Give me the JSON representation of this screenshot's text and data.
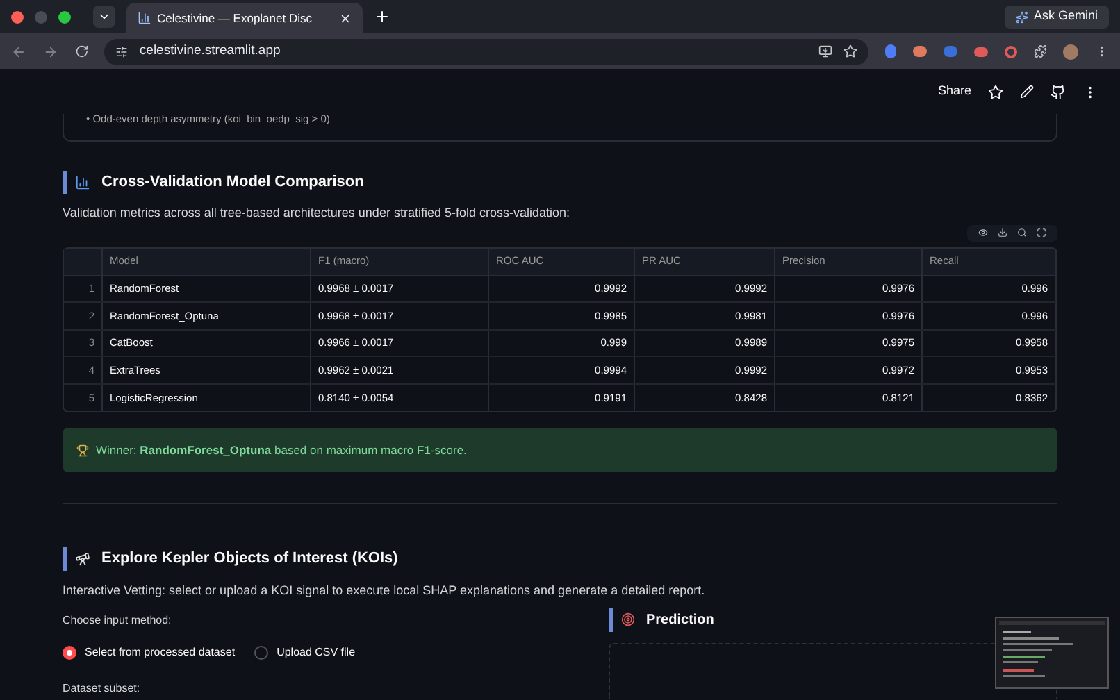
{
  "browser": {
    "tab_title": "Celestivine — Exoplanet Disc",
    "url": "celestivine.streamlit.app",
    "ask_button": "Ask Gemini"
  },
  "header": {
    "share": "Share"
  },
  "prev_note": "• Odd-even depth asymmetry (koi_bin_oedp_sig > 0)",
  "cv_section": {
    "title": "Cross-Validation Model Comparison",
    "intro": "Validation metrics across all tree-based architectures under stratified 5-fold cross-validation:",
    "table": {
      "columns": [
        "Model",
        "F1 (macro)",
        "ROC AUC",
        "PR AUC",
        "Precision",
        "Recall"
      ],
      "rows": [
        {
          "index": "1",
          "cells": [
            "RandomForest",
            "0.9968 ± 0.0017",
            "0.9992",
            "0.9992",
            "0.9976",
            "0.996"
          ]
        },
        {
          "index": "2",
          "cells": [
            "RandomForest_Optuna",
            "0.9968 ± 0.0017",
            "0.9985",
            "0.9981",
            "0.9976",
            "0.996"
          ]
        },
        {
          "index": "3",
          "cells": [
            "CatBoost",
            "0.9966 ± 0.0017",
            "0.999",
            "0.9989",
            "0.9975",
            "0.9958"
          ]
        },
        {
          "index": "4",
          "cells": [
            "ExtraTrees",
            "0.9962 ± 0.0021",
            "0.9994",
            "0.9992",
            "0.9972",
            "0.9953"
          ]
        },
        {
          "index": "5",
          "cells": [
            "LogisticRegression",
            "0.8140 ± 0.0054",
            "0.9191",
            "0.8428",
            "0.8121",
            "0.8362"
          ]
        }
      ]
    },
    "winner": {
      "label": "Winner:",
      "model": "RandomForest_Optuna",
      "rest": "based on maximum macro F1-score."
    }
  },
  "koi_section": {
    "title": "Explore Kepler Objects of Interest (KOIs)",
    "intro": "Interactive Vetting: select or upload a KOI signal to execute local SHAP explanations and generate a detailed report.",
    "input_label": "Choose input method:",
    "options": [
      {
        "label": "Select from processed dataset",
        "selected": true
      },
      {
        "label": "Upload CSV file",
        "selected": false
      }
    ],
    "subset_label": "Dataset subset:",
    "prediction_title": "Prediction"
  }
}
